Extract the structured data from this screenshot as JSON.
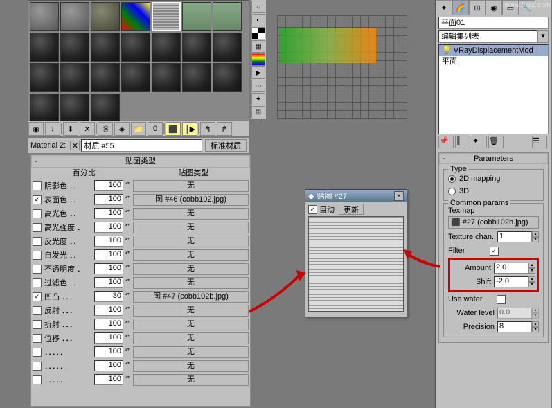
{
  "material_editor": {
    "name_label": "Material 2:",
    "material_name": "材质 #55",
    "material_type": "标准材质"
  },
  "maps_panel": {
    "header": "贴图类型",
    "col_percent": "百分比",
    "col_maptype": "贴图类型",
    "none_label": "无",
    "rows": [
      {
        "label": "阴影色 ．．",
        "amount": "100",
        "map": "无",
        "checked": false
      },
      {
        "label": "表面色 ．．",
        "amount": "100",
        "map": "图 #46 (cobb102.jpg)",
        "checked": true
      },
      {
        "label": "高光色 ．．",
        "amount": "100",
        "map": "无",
        "checked": false
      },
      {
        "label": "高光强度 ．",
        "amount": "100",
        "map": "无",
        "checked": false
      },
      {
        "label": "反光度 ．．",
        "amount": "100",
        "map": "无",
        "checked": false
      },
      {
        "label": "自发光 ．．",
        "amount": "100",
        "map": "无",
        "checked": false
      },
      {
        "label": "不透明度 ．",
        "amount": "100",
        "map": "无",
        "checked": false
      },
      {
        "label": "过滤色 ．．",
        "amount": "100",
        "map": "无",
        "checked": false
      },
      {
        "label": "凹凸 ．．．",
        "amount": "30",
        "map": "图 #47 (cobb102b.jpg)",
        "checked": true
      },
      {
        "label": "反射 ．．．",
        "amount": "100",
        "map": "无",
        "checked": false
      },
      {
        "label": "折射 ．．．",
        "amount": "100",
        "map": "无",
        "checked": false
      },
      {
        "label": "位移 ．．．",
        "amount": "100",
        "map": "无",
        "checked": false
      },
      {
        "label": "．．．．．",
        "amount": "100",
        "map": "无",
        "checked": false
      },
      {
        "label": "．．．．．",
        "amount": "100",
        "map": "无",
        "checked": false
      },
      {
        "label": "．．．．．",
        "amount": "100",
        "map": "无",
        "checked": false
      }
    ]
  },
  "tex_window": {
    "title": "贴图 #27",
    "auto_label": "自动",
    "update_label": "更新"
  },
  "right_panel": {
    "object_name": "平面01",
    "modifier_dropdown": "编辑集列表",
    "stack_items": [
      "VRayDisplacementMod",
      "平面"
    ],
    "parameters": {
      "header": "Parameters",
      "type_group": "Type",
      "type_2d": "2D mapping",
      "type_3d": "3D",
      "common_group": "Common params",
      "texmap_label": "Texmap",
      "texmap_slot": "#27 (cobb102b.jpg)",
      "texture_chan_label": "Texture chan.",
      "texture_chan_value": "1",
      "filter_label": "Filter",
      "amount_label": "Amount",
      "amount_value": "2.0",
      "shift_label": "Shift",
      "shift_value": "-2.0",
      "use_water_label": "Use water",
      "water_level_label": "Water level",
      "water_level_value": "0.0",
      "precision_label": "Precision",
      "precision_value": "8"
    }
  },
  "watermark": "www.hxsd.com"
}
